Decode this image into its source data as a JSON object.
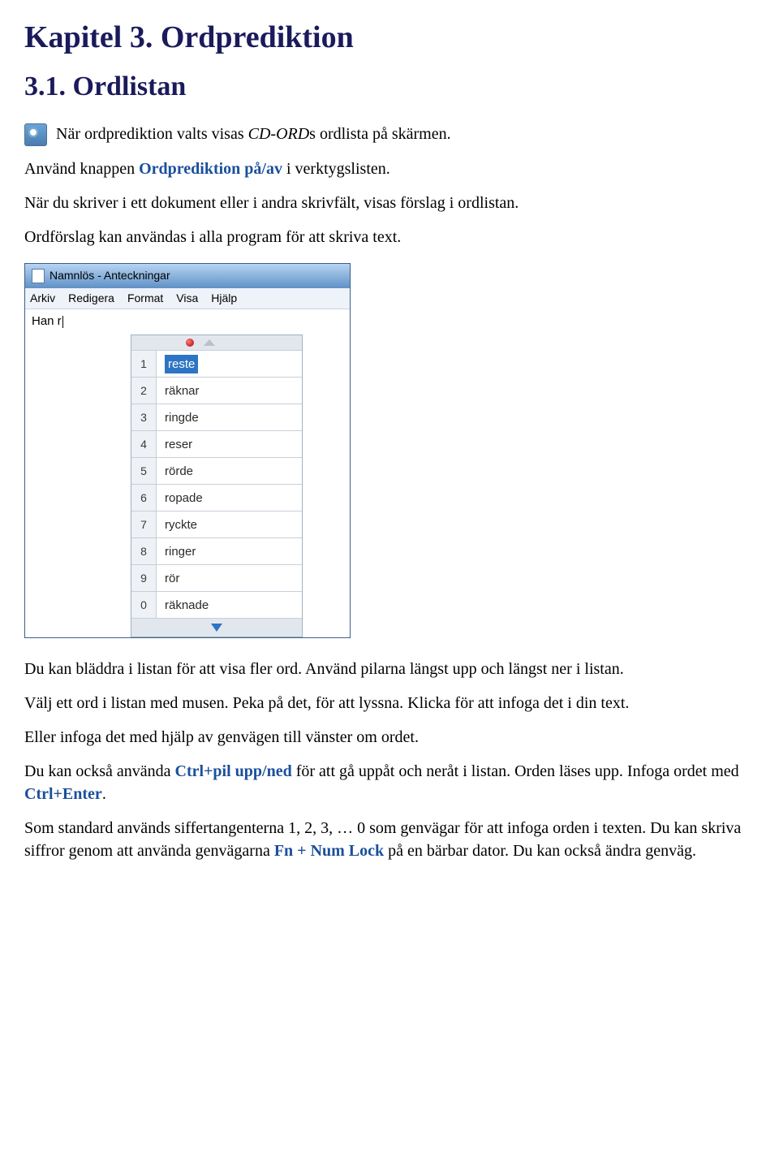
{
  "headings": {
    "chapter": "Kapitel 3. Ordprediktion",
    "section": "3.1. Ordlistan"
  },
  "intro": {
    "line1_pre": "När ordprediktion valts visas ",
    "line1_italic": "CD-ORD",
    "line1_post": "s ordlista på skärmen.",
    "line2_pre": "Använd knappen ",
    "line2_bold": "Ordprediktion på/av",
    "line2_post": " i verktygslisten.",
    "line3": "När du skriver i ett dokument eller i andra skrivfält, visas förslag i ordlistan.",
    "line4": "Ordförslag kan användas i alla program för att skriva text."
  },
  "notepad": {
    "title": "Namnlös - Anteckningar",
    "menu": [
      "Arkiv",
      "Redigera",
      "Format",
      "Visa",
      "Hjälp"
    ],
    "typed": "Han r"
  },
  "prediction": {
    "items": [
      {
        "num": "1",
        "word": "reste",
        "selected": true
      },
      {
        "num": "2",
        "word": "räknar"
      },
      {
        "num": "3",
        "word": "ringde"
      },
      {
        "num": "4",
        "word": "reser"
      },
      {
        "num": "5",
        "word": "rörde"
      },
      {
        "num": "6",
        "word": "ropade"
      },
      {
        "num": "7",
        "word": "ryckte"
      },
      {
        "num": "8",
        "word": "ringer"
      },
      {
        "num": "9",
        "word": "rör"
      },
      {
        "num": "0",
        "word": "räknade"
      }
    ]
  },
  "body": {
    "p1": "Du kan bläddra i listan för att visa fler ord. Använd pilarna längst upp och längst ner i listan.",
    "p2": "Välj ett ord i listan med musen. Peka på det, för att lyssna. Klicka för att infoga det i din text.",
    "p3": "Eller infoga det med hjälp av genvägen till vänster om ordet.",
    "p4_pre": "Du kan också använda ",
    "p4_b1": "Ctrl+pil upp/ned",
    "p4_mid": " för att gå uppåt och neråt i listan. Orden läses upp. Infoga ordet med ",
    "p4_b2": "Ctrl+Enter",
    "p4_post": ".",
    "p5_pre": "Som standard används siffertangenterna 1, 2, 3, … 0 som genvägar för att infoga orden i texten. Du kan skriva siffror genom att använda genvägarna ",
    "p5_b": "Fn + Num Lock",
    "p5_post": " på en bärbar dator. Du kan också ändra genväg."
  }
}
